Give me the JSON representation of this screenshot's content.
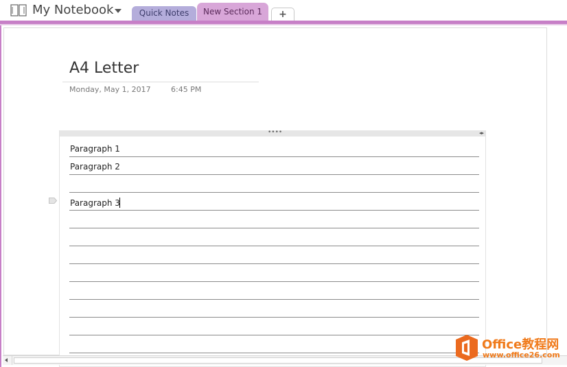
{
  "notebook": {
    "name": "My Notebook",
    "icon": "notebook-icon"
  },
  "tabs": [
    {
      "label": "Quick Notes",
      "color": "#b4addb"
    },
    {
      "label": "New Section 1",
      "color": "#d8a6d8",
      "active": true
    },
    {
      "label": "+"
    }
  ],
  "page": {
    "title": "A4 Letter",
    "date": "Monday, May 1, 2017",
    "time": "6:45 PM"
  },
  "container": {
    "handle_dots": "••••",
    "resize_glyph": "◂▸",
    "paragraphs": [
      "Paragraph 1",
      "Paragraph 2",
      "",
      "Paragraph 3"
    ]
  },
  "watermark": {
    "brand": "Office教程网",
    "url": "www.office26.com"
  },
  "colors": {
    "section_accent": "#c77fc7",
    "watermark_orange": "#f07a1a"
  }
}
